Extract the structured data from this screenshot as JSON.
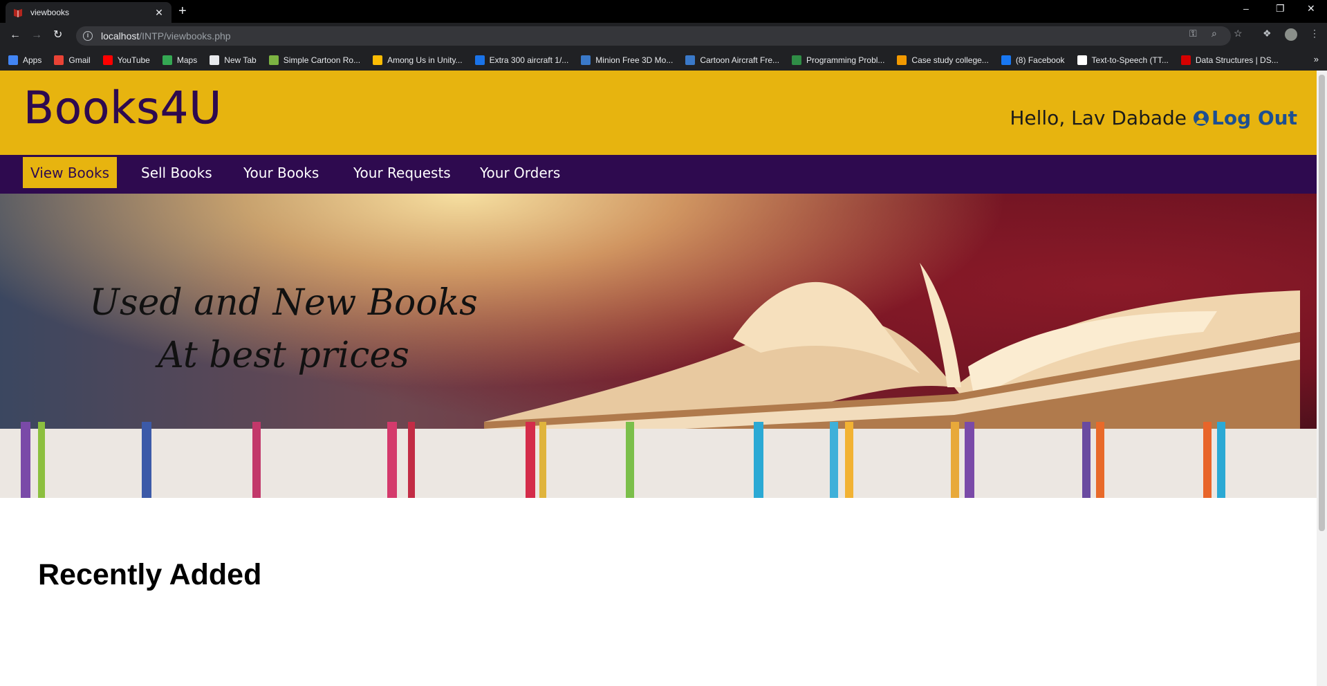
{
  "browser": {
    "tab_title": "viewbooks",
    "tab_close": "✕",
    "new_tab": "+",
    "url_host": "localhost",
    "url_path": "/INTP/viewbooks.php",
    "bookmarks": [
      {
        "label": "Apps",
        "color": "#4285f4"
      },
      {
        "label": "Gmail",
        "color": "#ea4335"
      },
      {
        "label": "YouTube",
        "color": "#ff0000"
      },
      {
        "label": "Maps",
        "color": "#34a853"
      },
      {
        "label": "New Tab",
        "color": "#e8eaed"
      },
      {
        "label": "Simple Cartoon Ro...",
        "color": "#7cb342"
      },
      {
        "label": "Among Us in Unity...",
        "color": "#fbbc04"
      },
      {
        "label": "Extra 300 aircraft 1/...",
        "color": "#1a73e8"
      },
      {
        "label": "Minion Free 3D Mo...",
        "color": "#3a79c9"
      },
      {
        "label": "Cartoon Aircraft Fre...",
        "color": "#3a79c9"
      },
      {
        "label": "Programming Probl...",
        "color": "#2f8d46"
      },
      {
        "label": "Case study college...",
        "color": "#f29900"
      },
      {
        "label": "(8) Facebook",
        "color": "#1877f2"
      },
      {
        "label": "Text-to-Speech (TT...",
        "color": "#ffffff"
      },
      {
        "label": "Data Structures | DS...",
        "color": "#d50000"
      }
    ],
    "bookmarks_more": "»"
  },
  "site": {
    "logo": "Books4U",
    "greeting": "Hello, Lav Dabade",
    "logout_label": "Log Out",
    "nav": [
      "View Books",
      "Sell Books",
      "Your Books",
      "Your Requests",
      "Your Orders"
    ],
    "active_nav": "View Books",
    "banner_line1": "Used and New Books",
    "banner_line2": "At best prices",
    "section_title": "Recently Added",
    "colors": {
      "header": "#e7b40f",
      "nav": "#2e0a4f",
      "logout": "#1d4f91"
    }
  }
}
